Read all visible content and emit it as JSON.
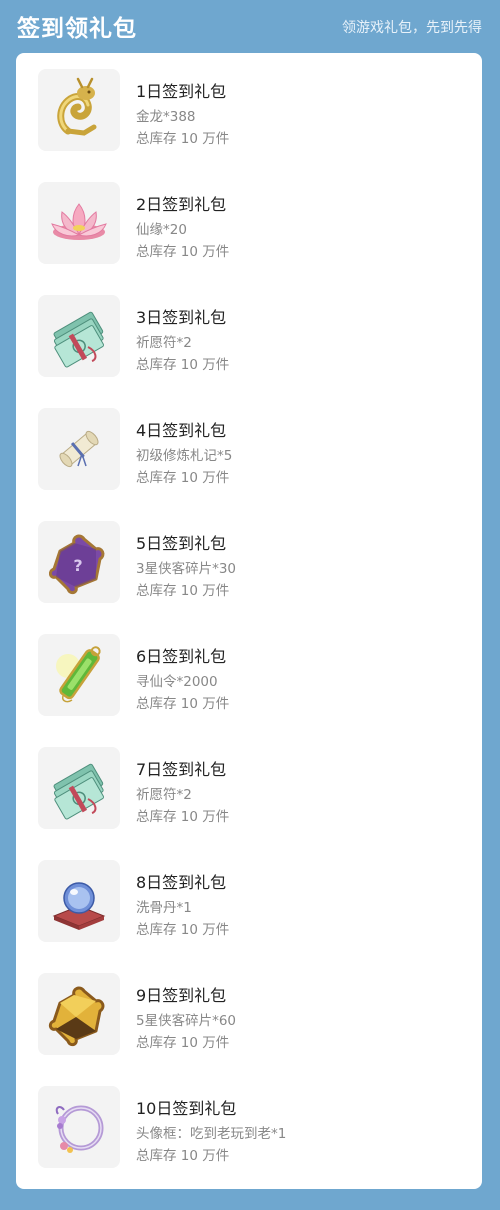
{
  "header": {
    "title": "签到领礼包",
    "subtitle": "领游戏礼包，先到先得"
  },
  "items": [
    {
      "title": "1日签到礼包",
      "reward": "金龙*388",
      "stock": "总库存 10 万件",
      "icon": "gold-dragon-icon"
    },
    {
      "title": "2日签到礼包",
      "reward": "仙缘*20",
      "stock": "总库存 10 万件",
      "icon": "lotus-icon"
    },
    {
      "title": "3日签到礼包",
      "reward": "祈愿符*2",
      "stock": "总库存 10 万件",
      "icon": "talisman-icon"
    },
    {
      "title": "4日签到礼包",
      "reward": "初级修炼札记*5",
      "stock": "总库存 10 万件",
      "icon": "scroll-icon"
    },
    {
      "title": "5日签到礼包",
      "reward": "3星侠客碎片*30",
      "stock": "总库存 10 万件",
      "icon": "puzzle-piece-purple-icon"
    },
    {
      "title": "6日签到礼包",
      "reward": "寻仙令*2000",
      "stock": "总库存 10 万件",
      "icon": "jade-token-icon"
    },
    {
      "title": "7日签到礼包",
      "reward": "祈愿符*2",
      "stock": "总库存 10 万件",
      "icon": "talisman-icon"
    },
    {
      "title": "8日签到礼包",
      "reward": "洗骨丹*1",
      "stock": "总库存 10 万件",
      "icon": "crystal-orb-icon"
    },
    {
      "title": "9日签到礼包",
      "reward": "5星侠客碎片*60",
      "stock": "总库存 10 万件",
      "icon": "puzzle-piece-gold-icon"
    },
    {
      "title": "10日签到礼包",
      "reward": "头像框：吃到老玩到老*1",
      "stock": "总库存 10 万件",
      "icon": "avatar-frame-icon"
    }
  ]
}
